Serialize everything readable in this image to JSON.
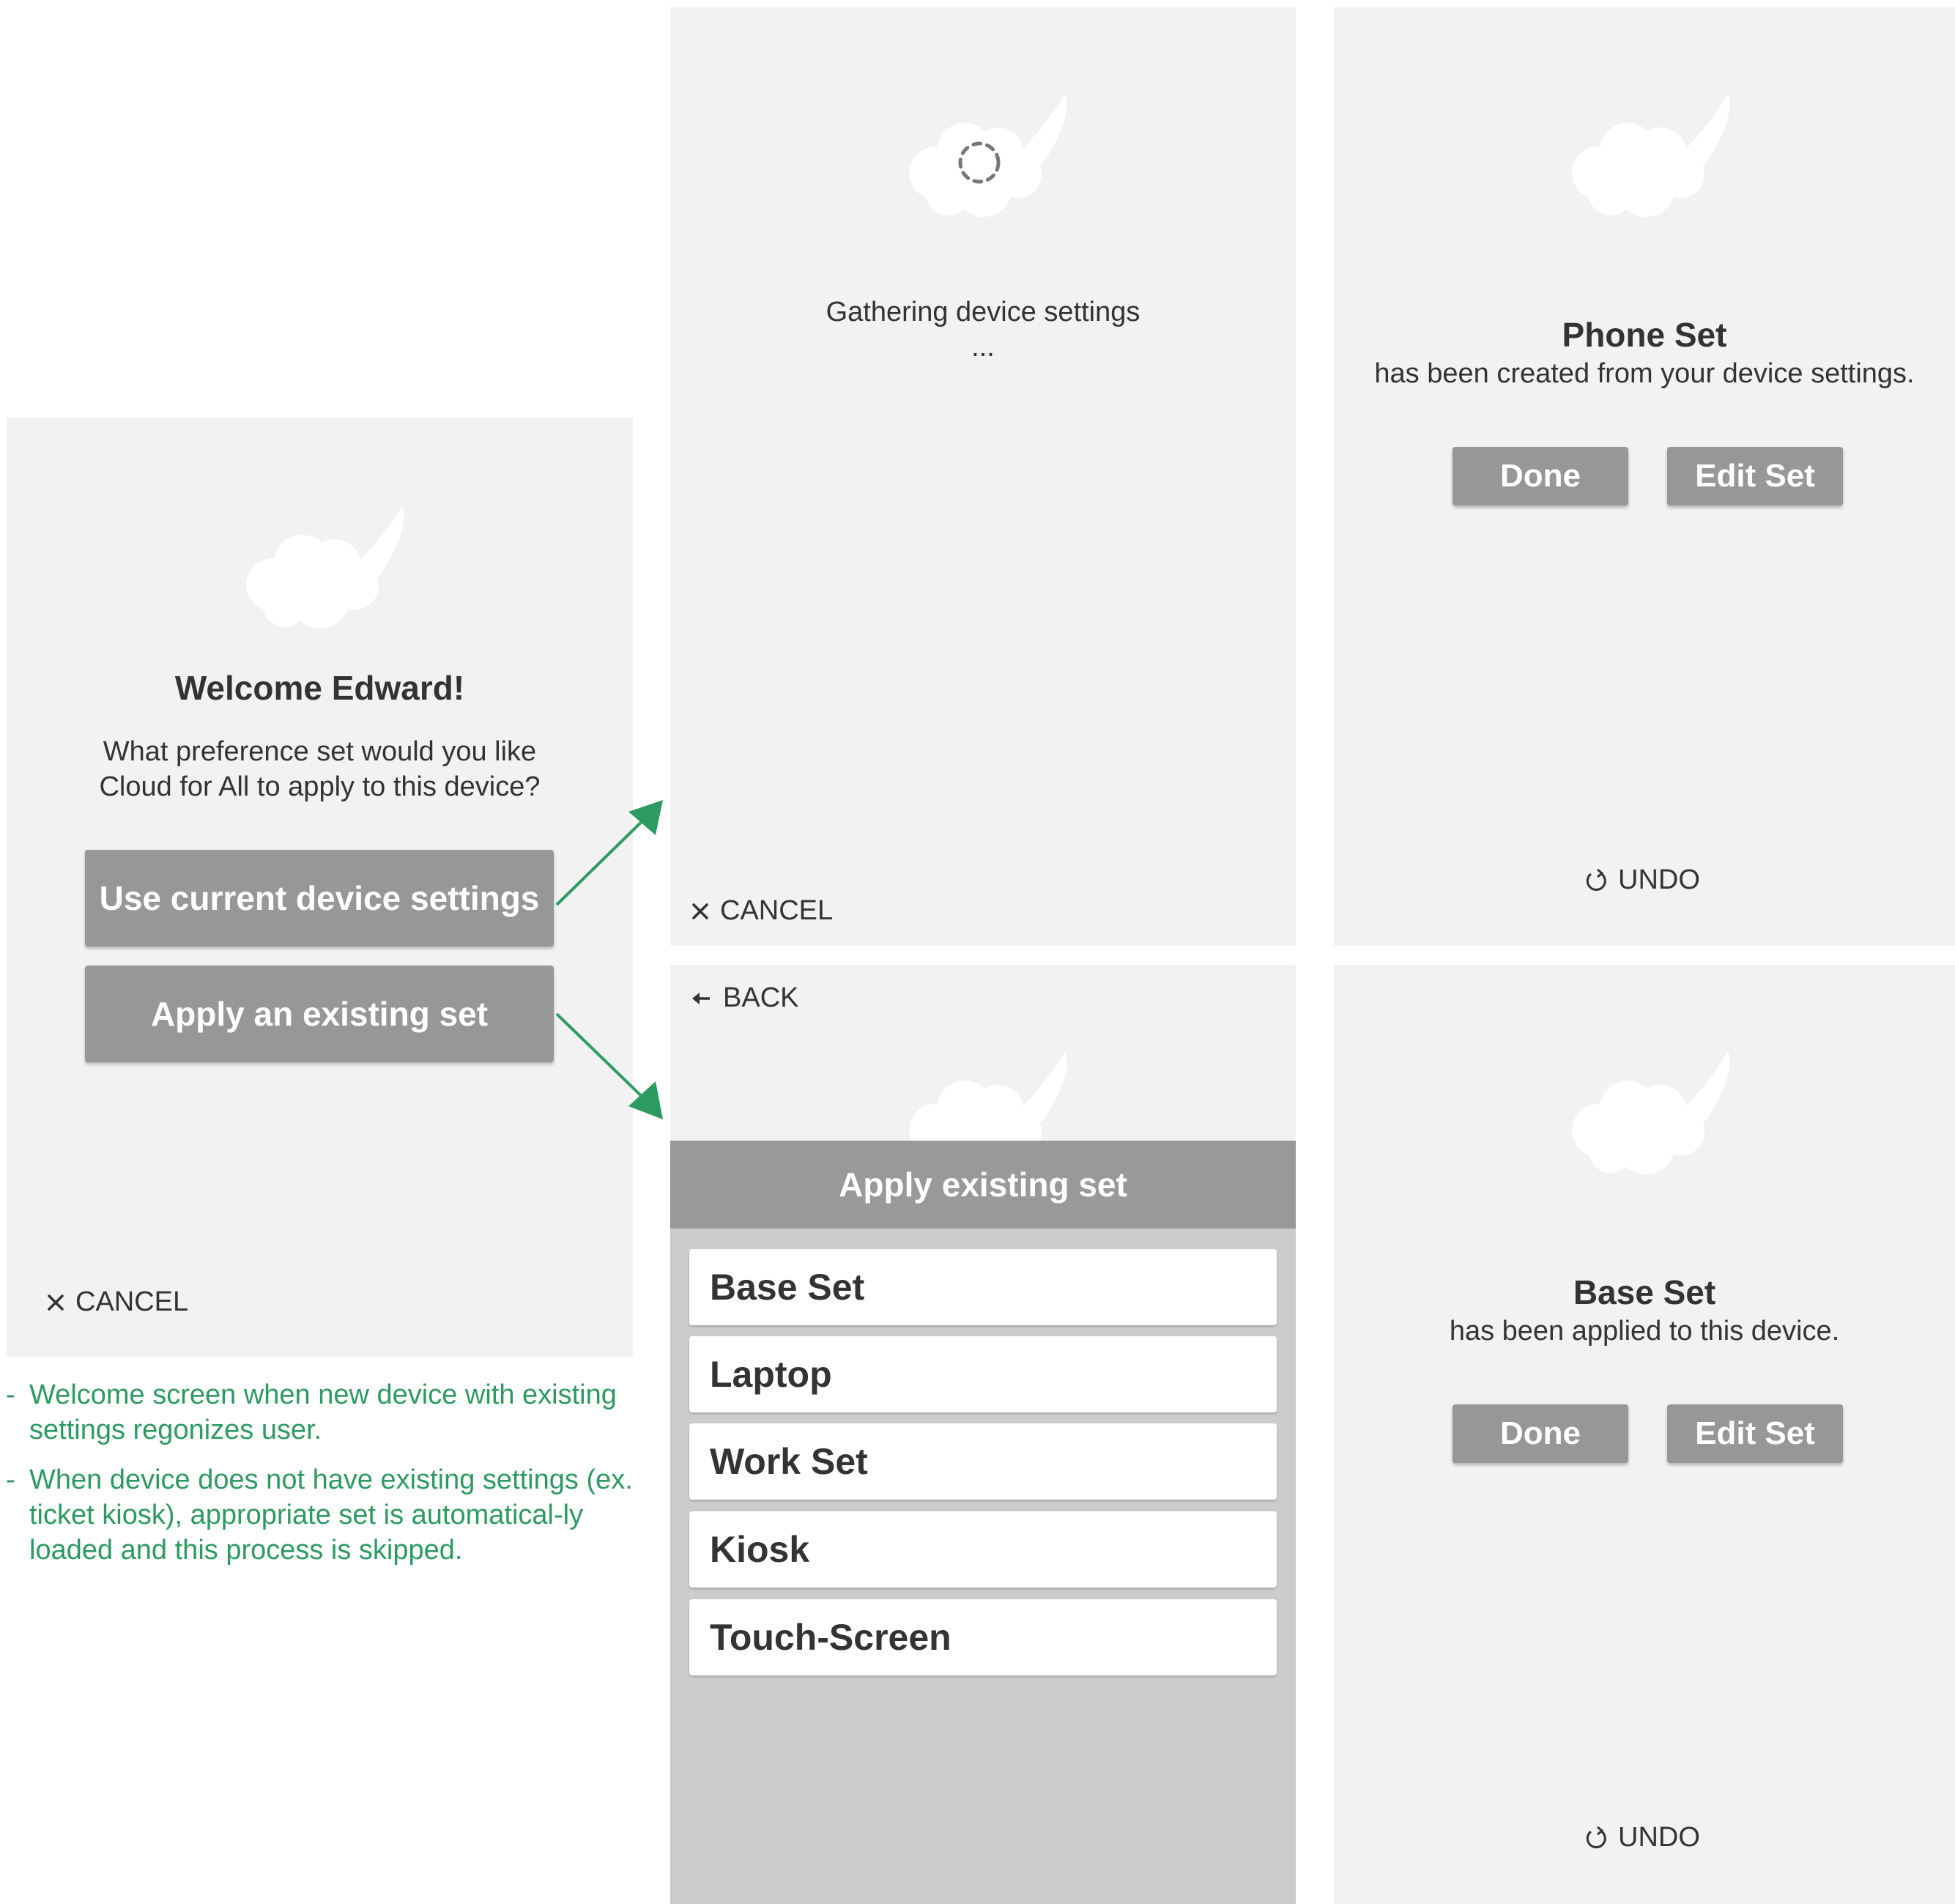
{
  "welcome": {
    "title": "Welcome Edward!",
    "question_line1": "What preference set would you like",
    "question_line2": "Cloud for All to apply to this device?",
    "use_current_label": "Use current device settings",
    "apply_existing_label": "Apply an existing set",
    "cancel_label": "CANCEL"
  },
  "notes": [
    {
      "dash": "-",
      "text": "Welcome screen when new device with existing settings regonizes user."
    },
    {
      "dash": "-",
      "text": "When device does not have existing settings (ex. ticket kiosk), appropriate set is automatical-ly loaded and this process is skipped."
    }
  ],
  "gathering": {
    "status": "Gathering device settings",
    "ellipsis": "...",
    "cancel_label": "CANCEL"
  },
  "phone_created": {
    "set_name": "Phone Set",
    "message": "has been created from your device settings.",
    "done_label": "Done",
    "edit_label": "Edit Set",
    "undo_label": "UNDO"
  },
  "apply_existing": {
    "back_label": "BACK",
    "header": "Apply existing set",
    "sets": [
      "Base Set",
      "Laptop",
      "Work Set",
      "Kiosk",
      "Touch-Screen"
    ]
  },
  "base_applied": {
    "set_name": "Base Set",
    "message": "has been applied to this device.",
    "done_label": "Done",
    "edit_label": "Edit Set",
    "undo_label": "UNDO"
  },
  "colors": {
    "panel_bg": "#f2f2f2",
    "button_gray": "#979797",
    "modal_bg": "#cccccc",
    "modal_header": "#999999",
    "annotation_green": "#2d9a62"
  },
  "icons": {
    "cloud": "cloud-logo-icon",
    "spinner": "loading-spinner-icon",
    "cancel": "close-icon",
    "back": "arrow-left-icon",
    "undo": "undo-icon"
  }
}
